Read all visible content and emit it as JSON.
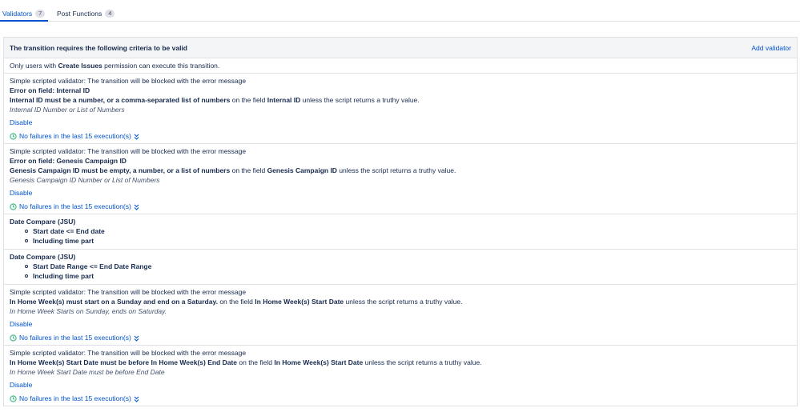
{
  "tabs": [
    {
      "label": "Validators",
      "count": "7"
    },
    {
      "label": "Post Functions",
      "count": "4"
    }
  ],
  "panel": {
    "title": "The transition requires the following criteria to be valid",
    "add_label": "Add validator"
  },
  "permission": {
    "prefix": "Only users with",
    "perm": "Create Issues",
    "suffix": "permission can execute this transition."
  },
  "scripted": [
    {
      "intro": "Simple scripted validator: The transition will be blocked with the error message",
      "error_on": "Error on field: Internal ID",
      "msg_bold": "Internal ID must be a number, or a comma-separated list of numbers",
      "msg_mid": "on the field",
      "field": "Internal ID",
      "msg_tail": "unless the script returns a truthy value.",
      "note": "Internal ID Number or List of Numbers",
      "disable": "Disable",
      "exec": "No failures in the last 15 execution(s)"
    },
    {
      "intro": "Simple scripted validator: The transition will be blocked with the error message",
      "error_on": "Error on field: Genesis Campaign ID",
      "msg_bold": "Genesis Campaign ID must be empty, a number, or a list of numbers",
      "msg_mid": "on the field",
      "field": "Genesis Campaign ID",
      "msg_tail": "unless the script returns a truthy value.",
      "note": "Genesis Campaign ID Number or List of Numbers",
      "disable": "Disable",
      "exec": "No failures in the last 15 execution(s)"
    },
    {
      "intro": "Simple scripted validator: The transition will be blocked with the error message",
      "msg_bold": "In Home Week(s) must start on a Sunday and end on a Saturday.",
      "msg_mid": "on the field",
      "field": "In Home Week(s) Start Date",
      "msg_tail": "unless the script returns a truthy value.",
      "note": "In Home Week Starts on Sunday, ends on Saturday.",
      "disable": "Disable",
      "exec": "No failures in the last 15 execution(s)"
    },
    {
      "intro": "Simple scripted validator: The transition will be blocked with the error message",
      "msg_bold": "In Home Week(s) Start Date must be before In Home Week(s) End Date",
      "msg_mid": "on the field",
      "field": "In Home Week(s) Start Date",
      "msg_tail": "unless the script returns a truthy value.",
      "note": "In Home Week Start Date must be before End Date",
      "disable": "Disable",
      "exec": "No failures in the last 15 execution(s)"
    }
  ],
  "date_compare": [
    {
      "title": "Date Compare (JSU)",
      "items": [
        "Start date <= End date",
        "Including time part"
      ]
    },
    {
      "title": "Date Compare (JSU)",
      "items": [
        "Start Date Range <= End Date Range",
        "Including time part"
      ]
    }
  ],
  "colors": {
    "accent": "#0052cc",
    "success": "#36b37e",
    "border": "#dfe1e6"
  }
}
